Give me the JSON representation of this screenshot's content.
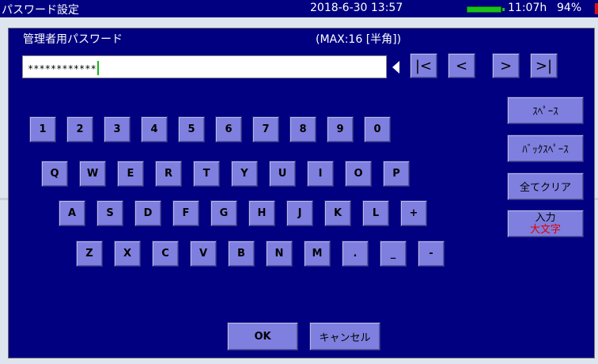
{
  "statusbar": {
    "app_title": "パスワード設定",
    "datetime": "2018-6-30 13:57",
    "battery_time": "11:07h",
    "battery_pct": "94%"
  },
  "dialog": {
    "title": "管理者用パスワード",
    "max_label": "(MAX:16 [半角])",
    "password_value": "************"
  },
  "nav": {
    "first": "|<",
    "prev": "<",
    "next": ">",
    "last": ">|"
  },
  "side": {
    "space": "ｽﾍﾟｰｽ",
    "backspace": "ﾊﾞｯｸｽﾍﾟｰｽ",
    "clear_all": "全てクリア",
    "input": "入力",
    "mode": "大文字"
  },
  "keys": {
    "row1": [
      "1",
      "2",
      "3",
      "4",
      "5",
      "6",
      "7",
      "8",
      "9",
      "0"
    ],
    "row2": [
      "Q",
      "W",
      "E",
      "R",
      "T",
      "Y",
      "U",
      "I",
      "O",
      "P"
    ],
    "row3": [
      "A",
      "S",
      "D",
      "F",
      "G",
      "H",
      "J",
      "K",
      "L",
      "+"
    ],
    "row4": [
      "Z",
      "X",
      "C",
      "V",
      "B",
      "N",
      "M",
      ".",
      "_",
      "-"
    ]
  },
  "footer": {
    "ok": "OK",
    "cancel": "キャンセル"
  }
}
